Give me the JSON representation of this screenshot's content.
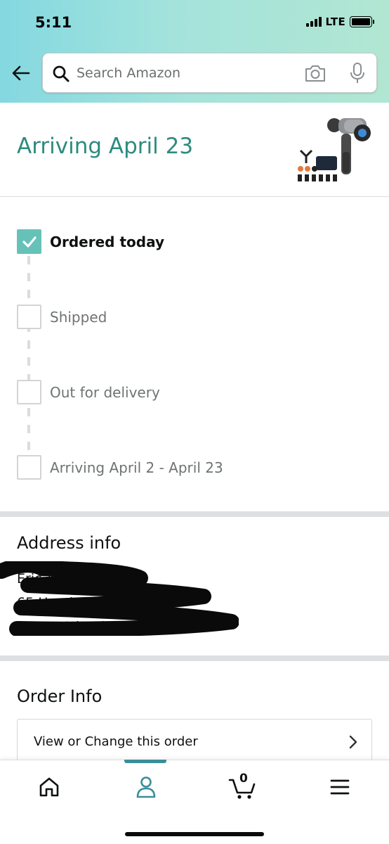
{
  "status_bar": {
    "time": "5:11",
    "network": "LTE"
  },
  "search": {
    "placeholder": "Search Amazon"
  },
  "shipment": {
    "arriving_title": "Arriving April 23"
  },
  "tracker": {
    "steps": [
      {
        "label": "Ordered today",
        "completed": true
      },
      {
        "label": "Shipped",
        "completed": false
      },
      {
        "label": "Out for delivery",
        "completed": false
      },
      {
        "label": "Arriving April 2 - April 23",
        "completed": false
      }
    ]
  },
  "address": {
    "title": "Address info",
    "lines": [
      "Eric Aynes",
      "65 Hemlock Street",
      "Staten Island, New York 10309"
    ]
  },
  "order_info": {
    "title": "Order Info",
    "view_change_label": "View or Change this order"
  },
  "bottom_nav": {
    "cart_count": "0",
    "active_tab": "account",
    "items": [
      "home-icon",
      "account-icon",
      "cart-icon",
      "menu-icon"
    ]
  },
  "colors": {
    "accent": "#2c8b7e",
    "check": "#66c2b8",
    "nav_active": "#3a8e9a"
  }
}
